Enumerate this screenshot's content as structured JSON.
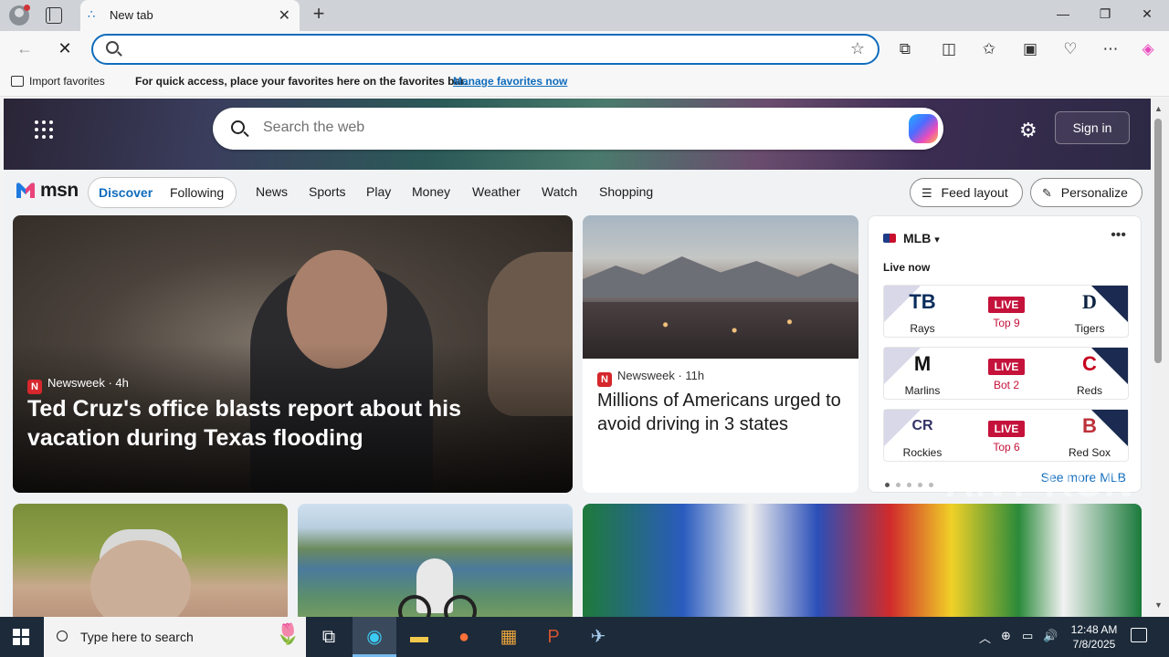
{
  "browser": {
    "tab_title": "New tab",
    "address_value": "",
    "favorites_bar": {
      "import_label": "Import favorites",
      "message": "For quick access, place your favorites here on the favorites bar.",
      "manage_link": "Manage favorites now"
    }
  },
  "msn": {
    "search_placeholder": "Search the web",
    "sign_in": "Sign in",
    "logo_text": "msn",
    "pill": {
      "discover": "Discover",
      "following": "Following"
    },
    "nav": [
      "News",
      "Sports",
      "Play",
      "Money",
      "Weather",
      "Watch",
      "Shopping"
    ],
    "feed_layout": "Feed layout",
    "personalize": "Personalize",
    "hero": {
      "source": "Newsweek",
      "age": "4h",
      "title": "Ted Cruz's office blasts report about his vacation during Texas flooding"
    },
    "mid": {
      "source": "Newsweek",
      "age": "11h",
      "title": "Millions of Americans urged to avoid driving in 3 states"
    },
    "mlb": {
      "title": "MLB",
      "live_now": "Live now",
      "games": [
        {
          "away": "Rays",
          "away_logo": "TB",
          "home": "Tigers",
          "home_logo": "D",
          "status": "LIVE",
          "inning": "Top 9"
        },
        {
          "away": "Marlins",
          "away_logo": "M",
          "home": "Reds",
          "home_logo": "C",
          "status": "LIVE",
          "inning": "Bot 2"
        },
        {
          "away": "Rockies",
          "away_logo": "CR",
          "home": "Red Sox",
          "home_logo": "B",
          "status": "LIVE",
          "inning": "Top 6"
        }
      ],
      "see_more": "See more MLB"
    },
    "watermark": "ANY RUN"
  },
  "taskbar": {
    "search_placeholder": "Type here to search",
    "time": "12:48 AM",
    "date": "7/8/2025"
  },
  "colors": {
    "accent": "#0f6cbd",
    "live": "#c4123b"
  }
}
